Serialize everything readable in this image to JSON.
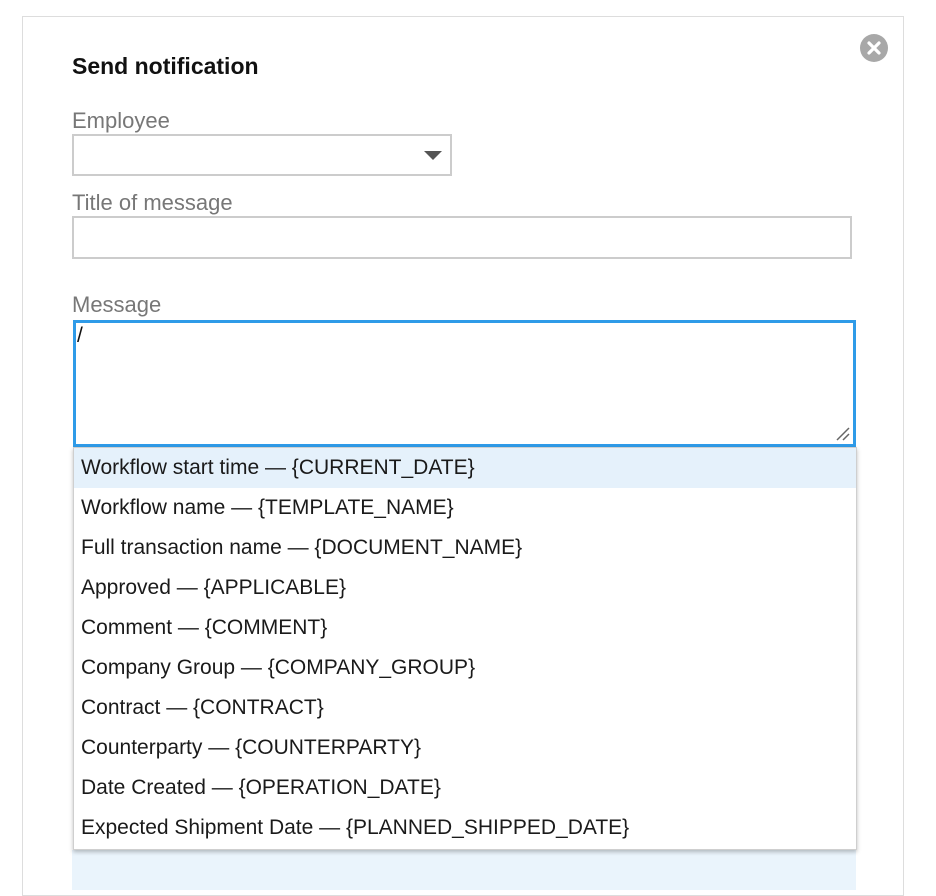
{
  "dialog": {
    "title": "Send notification",
    "close_icon": "close-circle-icon"
  },
  "form": {
    "employee_label": "Employee",
    "employee_value": "",
    "title_label": "Title of message",
    "title_value": "",
    "message_label": "Message",
    "message_value": "/"
  },
  "suggestions": [
    {
      "label": "Workflow start time — {CURRENT_DATE}"
    },
    {
      "label": "Workflow name — {TEMPLATE_NAME}"
    },
    {
      "label": "Full transaction name — {DOCUMENT_NAME}"
    },
    {
      "label": "Approved — {APPLICABLE}"
    },
    {
      "label": "Comment — {COMMENT}"
    },
    {
      "label": "Company Group — {COMPANY_GROUP}"
    },
    {
      "label": "Contract — {CONTRACT}"
    },
    {
      "label": "Counterparty — {COUNTERPARTY}"
    },
    {
      "label": "Date Created — {OPERATION_DATE}"
    },
    {
      "label": "Expected Shipment Date — {PLANNED_SHIPPED_DATE}"
    }
  ],
  "colors": {
    "focus_border": "#2f9be8",
    "highlight": "#e5f1fb"
  }
}
